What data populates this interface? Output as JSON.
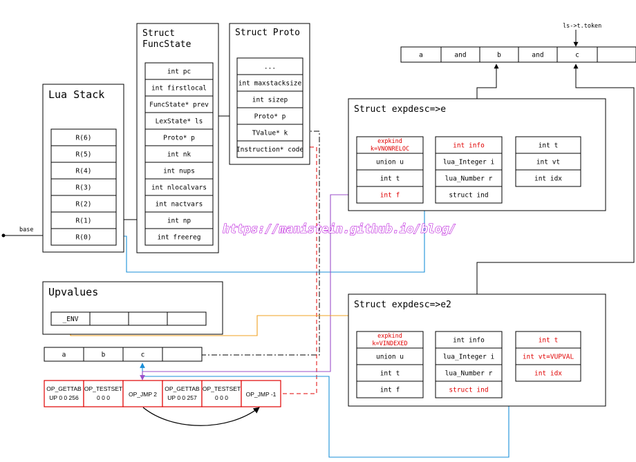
{
  "token": {
    "label": "ls->t.token"
  },
  "token_bar": {
    "cells": [
      "a",
      "and",
      "b",
      "and",
      "c",
      ""
    ]
  },
  "lua_stack": {
    "title": "Lua Stack",
    "slots": [
      "R(6)",
      "R(5)",
      "R(4)",
      "R(3)",
      "R(2)",
      "R(1)",
      "R(0)"
    ],
    "base_label": "base"
  },
  "func_state": {
    "title_line1": "Struct",
    "title_line2": "FuncState",
    "fields": [
      "int pc",
      "int firstlocal",
      "FuncState* prev",
      "LexState* ls",
      "Proto* p",
      "int nk",
      "int nups",
      "int nlocalvars",
      "int nactvars",
      "int np",
      "int freereg"
    ]
  },
  "proto": {
    "title": "Struct Proto",
    "fields": [
      "...",
      "int maxstacksize",
      "int sizep",
      "Proto* p",
      "TValue* k",
      "Instruction* code"
    ]
  },
  "expdesc_e": {
    "title": "Struct expdesc=>e",
    "fields": [
      "expkind k=VNONRELOC",
      "union u",
      "int t",
      "int f"
    ],
    "union_fields": [
      "int info",
      "lua_Integer i",
      "lua_Number r",
      "struct ind"
    ],
    "ind_fields": [
      "int t",
      "int vt",
      "int idx"
    ]
  },
  "expdesc_e2": {
    "title": "Struct expdesc=>e2",
    "fields": [
      "expkind k=VINDEXED",
      "union u",
      "int t",
      "int f"
    ],
    "union_fields": [
      "int info",
      "lua_Integer i",
      "lua_Number r",
      "struct ind"
    ],
    "ind_fields": [
      "int t",
      "int vt=VUPVAL",
      "int idx"
    ]
  },
  "upvalues": {
    "title": "Upvalues",
    "cells": [
      "_ENV",
      "",
      "",
      ""
    ]
  },
  "constants": {
    "cells": [
      "a",
      "b",
      "c",
      ""
    ]
  },
  "code": {
    "cells": [
      {
        "line1": "OP_GETTAB",
        "line2": "UP 0 0 256"
      },
      {
        "line1": "OP_TESTSET",
        "line2": "0 0 0"
      },
      {
        "line1": "OP_JMP 2",
        "line2": ""
      },
      {
        "line1": "OP_GETTAB",
        "line2": "UP 0 0 257"
      },
      {
        "line1": "OP_TESTSET",
        "line2": "0 0 0"
      },
      {
        "line1": "OP_JMP -1",
        "line2": ""
      }
    ]
  },
  "watermark": {
    "text": "https://manistein.github.io/blog/"
  },
  "colors": {
    "red": "#e00000",
    "blue": "#1a8fd8",
    "purple": "#9b4fc9",
    "orange": "#f0a020",
    "watermark": "#b400d8"
  }
}
